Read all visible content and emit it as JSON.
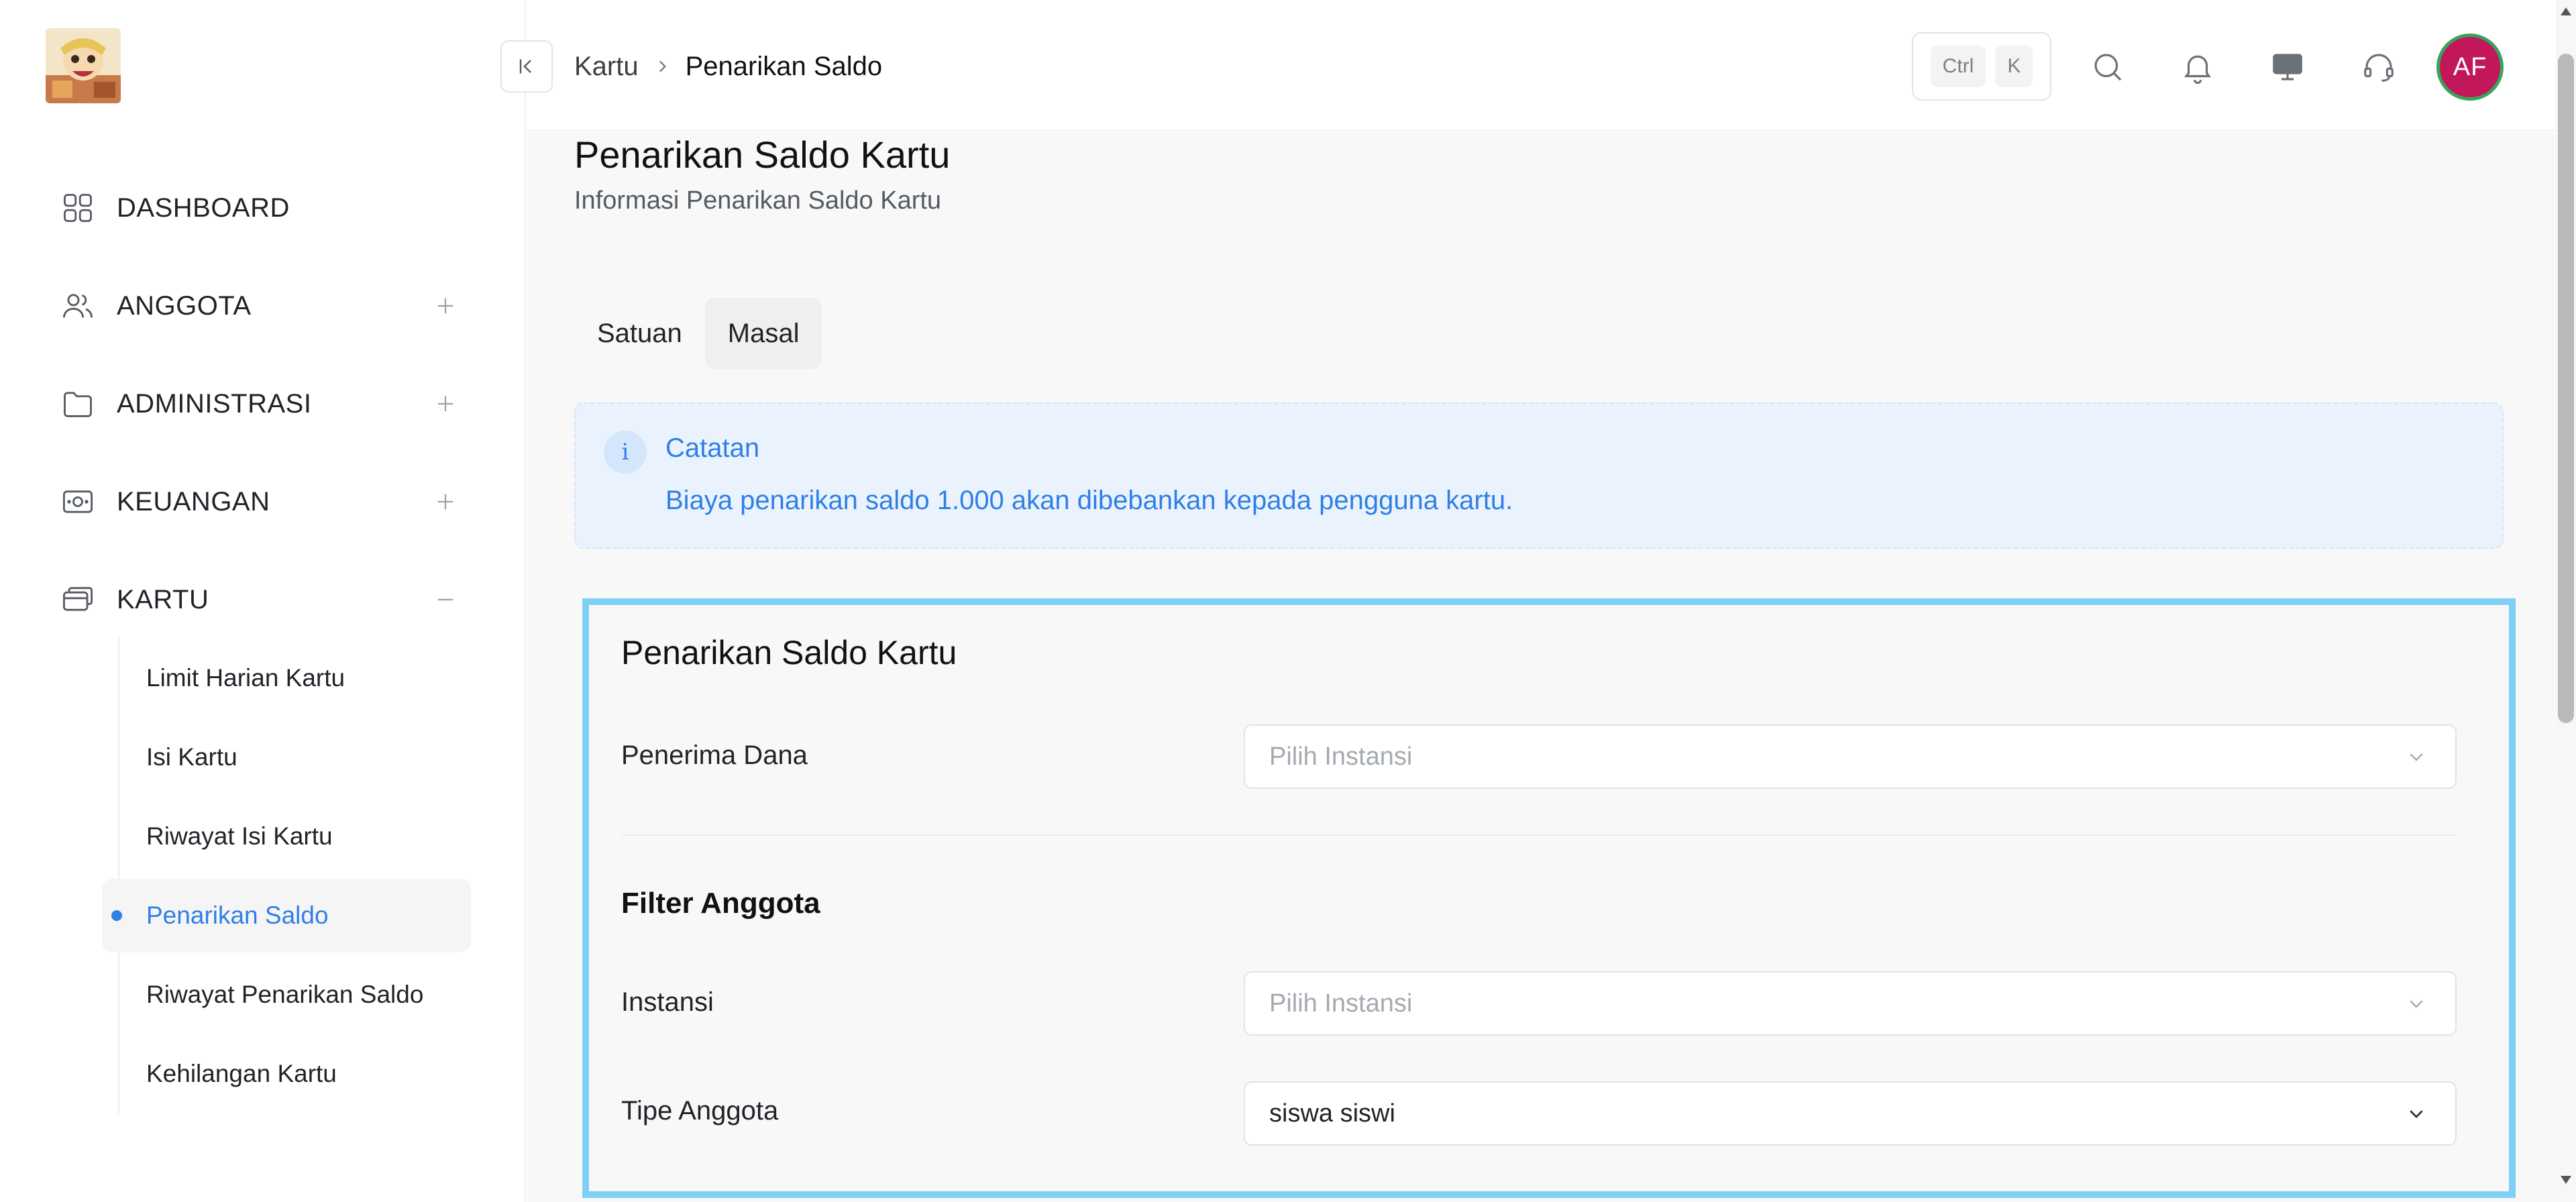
{
  "colors": {
    "accent": "#2f7fe6",
    "note_background": "#eaf3fd",
    "form_highlight_border": "#7fd0f5",
    "avatar_background": "#c2185b",
    "avatar_ring": "#3aa35b"
  },
  "sidebar": {
    "logo_icon": "app-logo-image",
    "items": [
      {
        "label": "DASHBOARD",
        "icon": "dashboard-grid-icon",
        "toggle": null
      },
      {
        "label": "ANGGOTA",
        "icon": "users-icon",
        "toggle": "+"
      },
      {
        "label": "ADMINISTRASI",
        "icon": "folder-icon",
        "toggle": "+"
      },
      {
        "label": "KEUANGAN",
        "icon": "cash-icon",
        "toggle": "+"
      },
      {
        "label": "KARTU",
        "icon": "card-icon",
        "toggle": "−"
      }
    ],
    "sub_items": [
      {
        "label": "Limit Harian Kartu",
        "active": false
      },
      {
        "label": "Isi Kartu",
        "active": false
      },
      {
        "label": "Riwayat Isi Kartu",
        "active": false
      },
      {
        "label": "Penarikan Saldo",
        "active": true
      },
      {
        "label": "Riwayat Penarikan Saldo",
        "active": false
      },
      {
        "label": "Kehilangan Kartu",
        "active": false
      }
    ]
  },
  "header": {
    "breadcrumb": {
      "parent": "Kartu",
      "current": "Penarikan Saldo"
    },
    "shortcut": {
      "key1": "Ctrl",
      "key2": "K"
    },
    "icons": [
      "search-icon",
      "bell-icon",
      "monitor-icon",
      "headset-icon"
    ],
    "avatar_initials": "AF"
  },
  "page": {
    "title": "Penarikan Saldo Kartu",
    "subtitle": "Informasi Penarikan Saldo Kartu",
    "tabs": [
      {
        "label": "Satuan",
        "active": false
      },
      {
        "label": "Masal",
        "active": true
      }
    ],
    "note": {
      "icon_glyph": "i",
      "title": "Catatan",
      "text": "Biaya penarikan saldo 1.000 akan dibebankan kepada pengguna kartu."
    }
  },
  "form": {
    "title": "Penarikan Saldo Kartu",
    "penerima_dana": {
      "label": "Penerima Dana",
      "placeholder": "Pilih Instansi"
    },
    "filter_title": "Filter Anggota",
    "instansi": {
      "label": "Instansi",
      "placeholder": "Pilih Instansi"
    },
    "tipe_anggota": {
      "label": "Tipe Anggota",
      "value": "siswa siswi"
    }
  }
}
